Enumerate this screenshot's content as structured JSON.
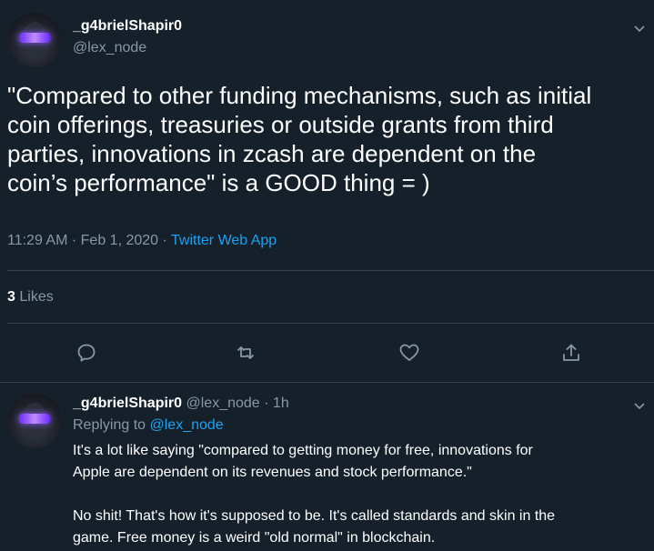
{
  "main_tweet": {
    "display_name": "_g4brielShapir0",
    "handle": "@lex_node",
    "text_lines": [
      "\"Compared to other funding mechanisms, such as initial",
      "coin offerings, treasuries or outside grants from third",
      "parties, innovations in zcash are dependent on the",
      "coin’s performance\" is a GOOD thing = )"
    ],
    "time": "11:29 AM",
    "sep1": "·",
    "date": "Feb 1, 2020",
    "sep2": "·",
    "source": "Twitter Web App",
    "likes_count": "3",
    "likes_label": "Likes"
  },
  "reply": {
    "display_name": "_g4brielShapir0",
    "handle": "@lex_node",
    "sep": "·",
    "age": "1h",
    "replying_prefix": "Replying to",
    "replying_handle": "@lex_node",
    "para1_lines": [
      "It's a lot like saying \"compared to getting money for free, innovations for",
      "Apple are dependent on its revenues and stock performance.\""
    ],
    "para2_lines": [
      "No shit! That's how it's supposed to be. It's called standards and skin in the",
      "game. Free money is a weird \"old normal\" in blockchain."
    ]
  },
  "icons": {
    "reply": "reply-icon",
    "retweet": "retweet-icon",
    "like": "like-icon",
    "share": "share-icon",
    "more": "chevron-down-icon"
  },
  "colors": {
    "background": "#15202b",
    "text": "#ffffff",
    "muted": "#8899a6",
    "accent": "#1da1f2",
    "divider": "#38444d"
  }
}
